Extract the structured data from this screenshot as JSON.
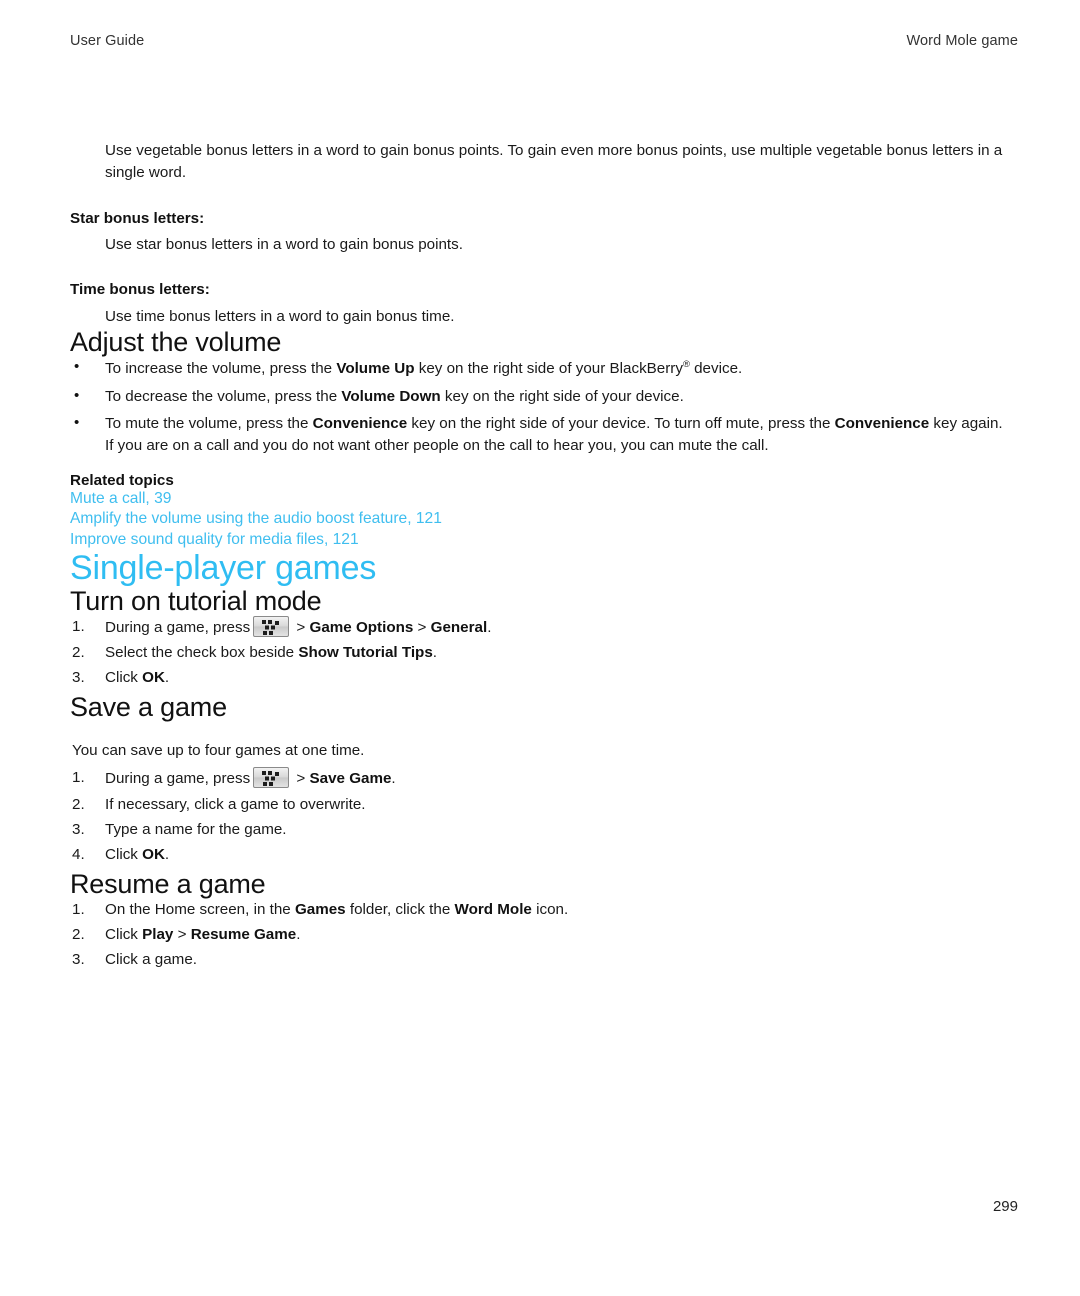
{
  "header": {
    "left": "User Guide",
    "right": "Word Mole game"
  },
  "colors": {
    "chapter_heading": "#2fbdf2",
    "link": "#3fbeef",
    "body_text": "#1a1a1a"
  },
  "intro": {
    "paragraph": "Use vegetable bonus letters in a word to gain bonus points. To gain even more bonus points, use multiple vegetable bonus letters in a single word."
  },
  "definitions": [
    {
      "term": "Star bonus letters:",
      "description": "Use star bonus letters in a word to gain bonus points."
    },
    {
      "term": "Time bonus letters:",
      "description": "Use time bonus letters in a word to gain bonus time."
    }
  ],
  "adjust_volume": {
    "heading": "Adjust the volume",
    "bullets": {
      "b1_a": "To increase the volume, press the ",
      "b1_b": "Volume Up",
      "b1_c": " key on the right side of your BlackBerry",
      "b1_sup": "®",
      "b1_d": " device.",
      "b2_a": "To decrease the volume, press the ",
      "b2_b": "Volume Down",
      "b2_c": " key on the right side of your device.",
      "b3_a": "To mute the volume, press the ",
      "b3_b": "Convenience",
      "b3_c": " key on the right side of your device. To turn off mute, press the ",
      "b3_d": "Convenience",
      "b3_e": " key again. If you are on a call and you do not want other people on the call to hear you, you can mute the call."
    },
    "related_topics": {
      "label": "Related topics",
      "links": [
        "Mute a call, 39",
        "Amplify the volume using the audio boost feature, 121",
        "Improve sound quality for media files, 121"
      ]
    }
  },
  "single_player": {
    "heading": "Single-player games"
  },
  "tutorial_mode": {
    "heading": "Turn on tutorial mode",
    "steps": {
      "s1_a": "During a game, press",
      "s1_icon": "blackberry-menu-key-icon",
      "s1_b": " > ",
      "s1_c": "Game Options",
      "s1_d": " > ",
      "s1_e": "General",
      "s1_f": ".",
      "s2_a": "Select the check box beside ",
      "s2_b": "Show Tutorial Tips",
      "s2_c": ".",
      "s3_a": "Click ",
      "s3_b": "OK",
      "s3_c": "."
    }
  },
  "save_game": {
    "heading": "Save a game",
    "intro": "You can save up to four games at one time.",
    "steps": {
      "s1_a": "During a game, press",
      "s1_icon": "blackberry-menu-key-icon",
      "s1_b": " > ",
      "s1_c": "Save Game",
      "s1_d": ".",
      "s2": "If necessary, click a game to overwrite.",
      "s3": "Type a name for the game.",
      "s4_a": "Click ",
      "s4_b": "OK",
      "s4_c": "."
    }
  },
  "resume_game": {
    "heading": "Resume a game",
    "steps": {
      "s1_a": "On the Home screen, in the ",
      "s1_b": "Games",
      "s1_c": " folder, click the ",
      "s1_d": "Word Mole",
      "s1_e": " icon.",
      "s2_a": "Click ",
      "s2_b": "Play",
      "s2_c": " > ",
      "s2_d": "Resume Game",
      "s2_e": ".",
      "s3": "Click a game."
    }
  },
  "footer": {
    "page_number": "299"
  }
}
